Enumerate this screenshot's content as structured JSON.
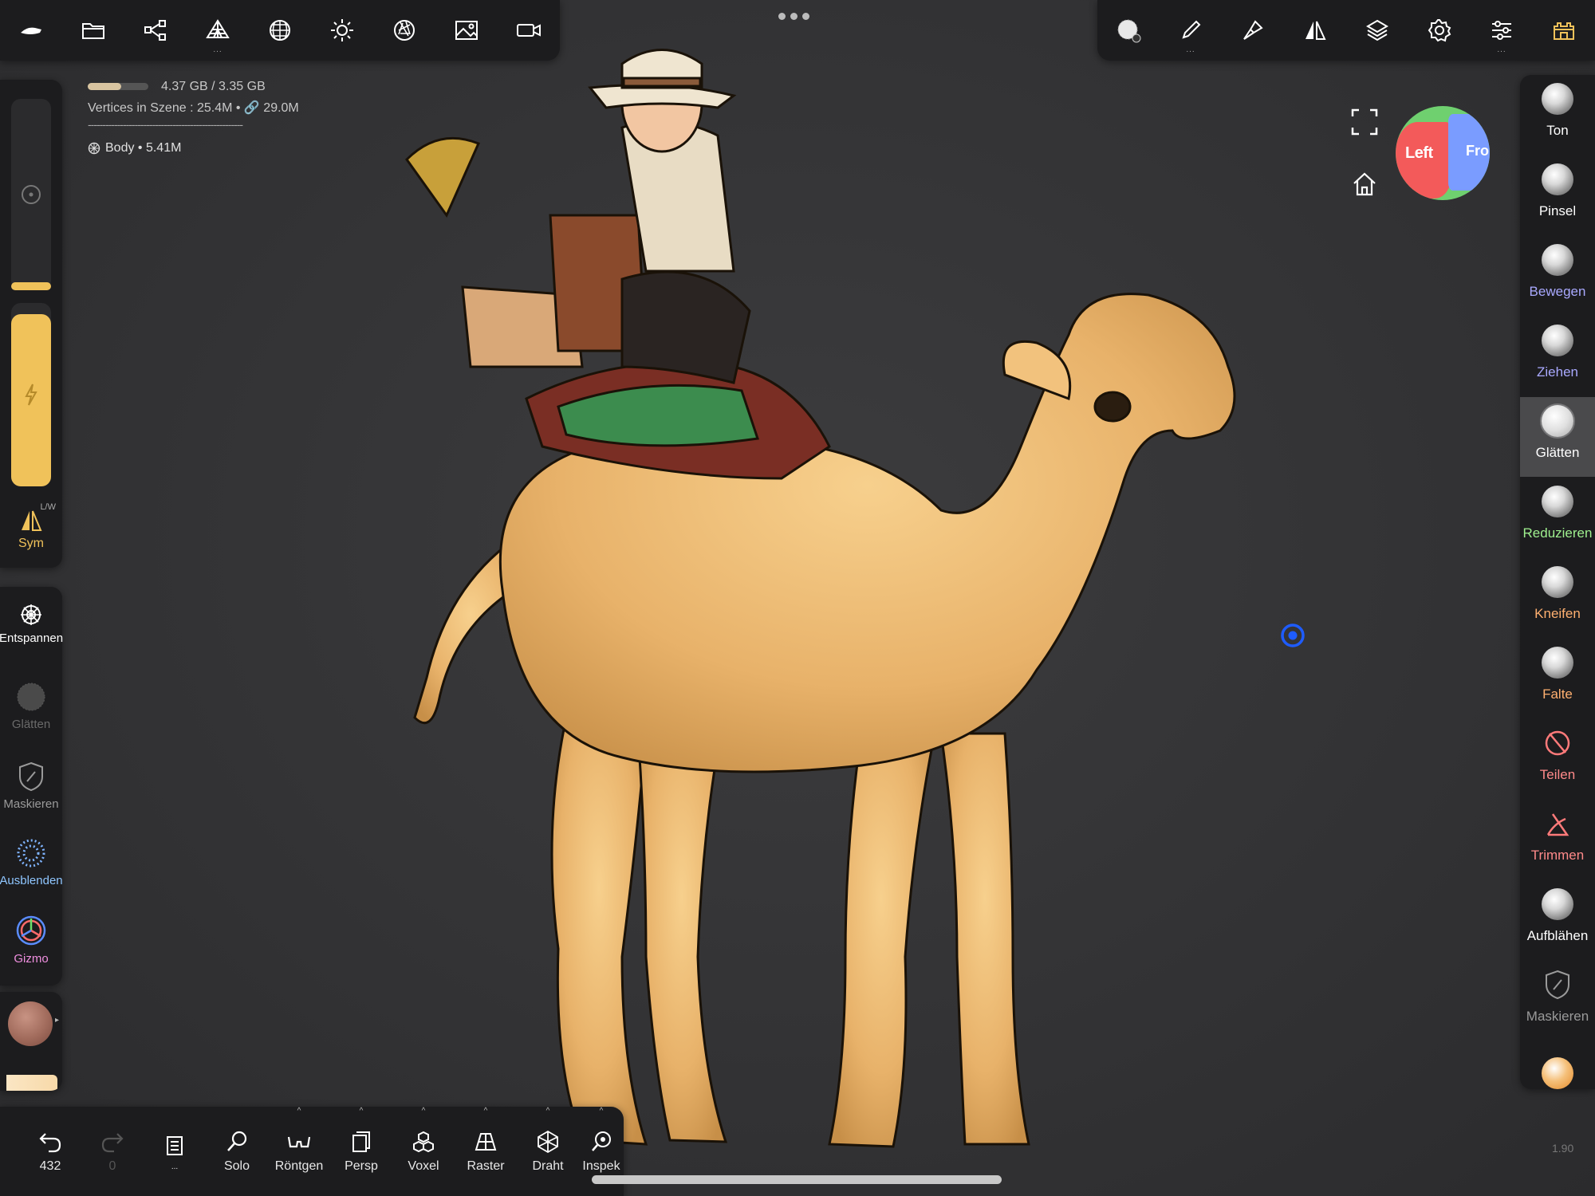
{
  "stats": {
    "memory": "4.37 GB / 3.35 GB",
    "vertices": "Vertices in Szene : 25.4M • 🔗 29.0M",
    "separator": "-----------------------------------------------------",
    "object": "Body • 5.41M"
  },
  "left": {
    "sym_label": "Sym",
    "sym_badge": "L/W",
    "items": [
      {
        "label": "Entspannen",
        "color": "#ffffff"
      },
      {
        "label": "Glätten",
        "color": "#6a6a6a"
      },
      {
        "label": "Maskieren",
        "color": "#9a9a9a"
      },
      {
        "label": "Ausblenden",
        "color": "#8fc6ff"
      },
      {
        "label": "Gizmo",
        "color": "#f08fe0"
      }
    ]
  },
  "right_tools": [
    {
      "label": "Ton",
      "color": "#ffffff"
    },
    {
      "label": "Pinsel",
      "color": "#ffffff"
    },
    {
      "label": "Bewegen",
      "color": "#a9a9ff"
    },
    {
      "label": "Ziehen",
      "color": "#a9a9ff"
    },
    {
      "label": "Glätten",
      "color": "#ffffff"
    },
    {
      "label": "Reduzieren",
      "color": "#9ff08f"
    },
    {
      "label": "Kneifen",
      "color": "#ffb070"
    },
    {
      "label": "Falte",
      "color": "#ffb070"
    },
    {
      "label": "Teilen",
      "color": "#ff8a8a"
    },
    {
      "label": "Trimmen",
      "color": "#ff8a8a"
    },
    {
      "label": "Aufblähen",
      "color": "#ffffff"
    },
    {
      "label": "Maskieren",
      "color": "#9a9a9a"
    }
  ],
  "bottom": {
    "undo_count": "432",
    "redo_count": "0",
    "items": [
      "Solo",
      "Röntgen",
      "Persp",
      "Voxel",
      "Raster",
      "Draht",
      "Inspek"
    ]
  },
  "navcube": {
    "left": "Left",
    "front": "Fron"
  },
  "version": "1.90"
}
